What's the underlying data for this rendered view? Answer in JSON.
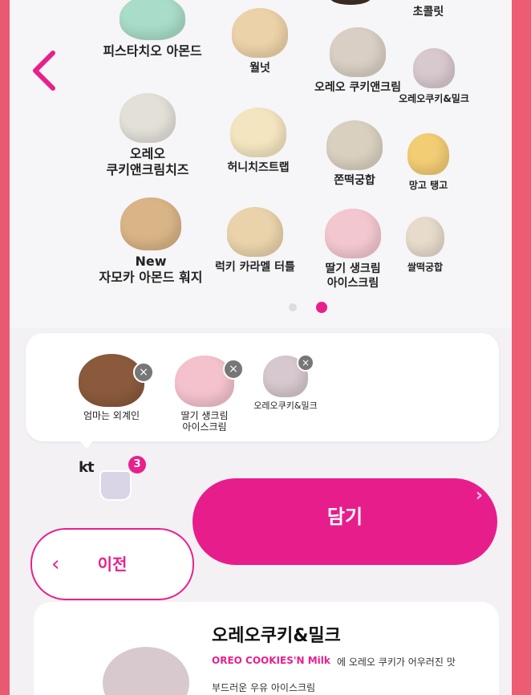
{
  "menu": {
    "flavors": [
      {
        "label": "피스타치오 아몬드",
        "color": "#a9dcc9"
      },
      {
        "label": "월넛",
        "color": "#ecd2a8"
      },
      {
        "label": "오레오 쿠키앤크림",
        "color": "#d9cfc4"
      },
      {
        "label": "오레오쿠키&밀크",
        "color": "#d8c9cf"
      },
      {
        "label": "오레오\n쿠키앤크림치즈",
        "color": "#e3e0d8"
      },
      {
        "label": "허니치즈트랩",
        "color": "#f3e5bf"
      },
      {
        "label": "쫀떡궁합",
        "color": "#d9d0bf"
      },
      {
        "label": "망고 탱고",
        "color": "#f2cd74"
      },
      {
        "label": "New\n자모카 아몬드 훠지",
        "color": "#d9b486"
      },
      {
        "label": "럭키 카라멜 터틀",
        "color": "#ead3ab"
      },
      {
        "label": "딸기 생크림\n아이스크림",
        "color": "#f3c7cf"
      },
      {
        "label": "쌀떡궁합",
        "color": "#e7dbcb"
      }
    ],
    "top_partial_label": "초콜릿"
  },
  "basket": {
    "items": [
      {
        "label": "엄마는 외계인",
        "color": "#8b5a3c"
      },
      {
        "label": "딸기 생크림\n아이스크림",
        "color": "#f4c2cc"
      },
      {
        "label": "오레오쿠키&밀크",
        "color": "#d6c8ce"
      }
    ],
    "remove_icon": "×"
  },
  "cart": {
    "brand": "kt",
    "count": "3"
  },
  "actions": {
    "add_label": "담기",
    "add_chevron": "›",
    "prev_label": "이전",
    "prev_chevron": "‹"
  },
  "detail": {
    "title": "오레오쿠키&밀크",
    "subtitle": "OREO COOKIES'N Milk",
    "description": "에 오레오 쿠키가 어우러진 맛",
    "description2": "부드러운 우유 아이스크림"
  },
  "colors": {
    "accent": "#e8208c",
    "bezel": "#e9566c"
  }
}
